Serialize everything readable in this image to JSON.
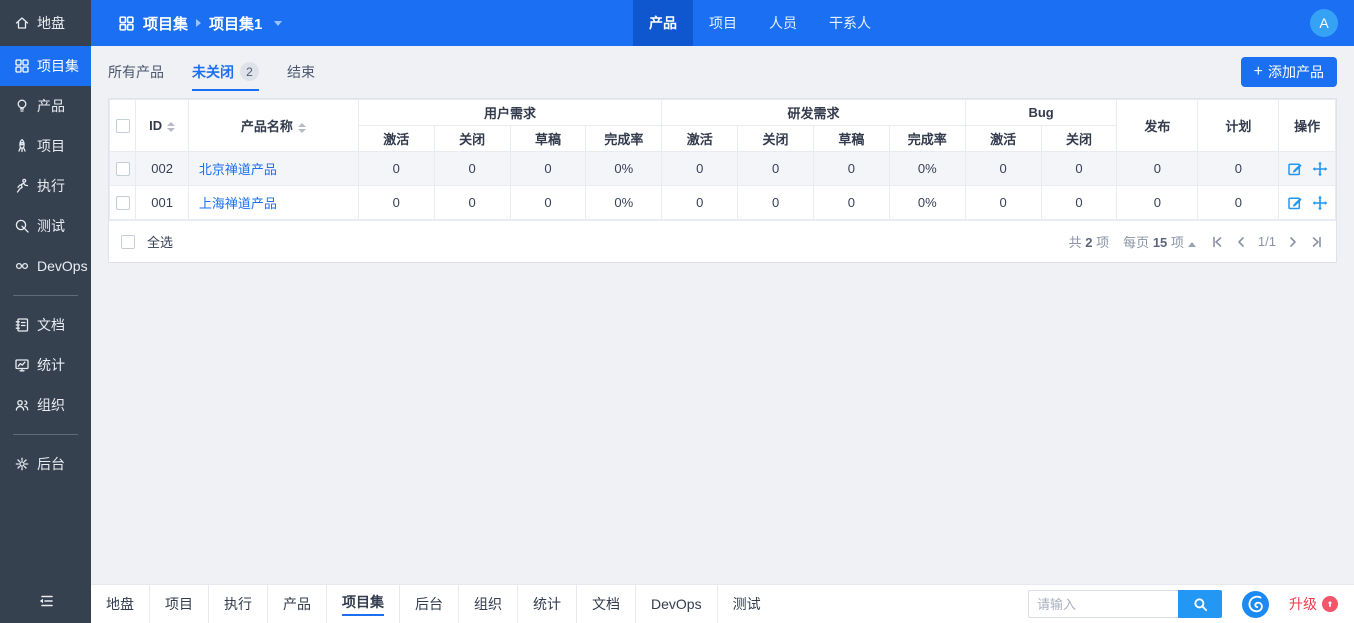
{
  "sidebar": {
    "items": [
      {
        "label": "地盘",
        "icon": "home",
        "active": false
      },
      {
        "label": "项目集",
        "icon": "grid",
        "active": true
      },
      {
        "label": "产品",
        "icon": "bulb",
        "active": false
      },
      {
        "label": "项目",
        "icon": "rocket",
        "active": false
      },
      {
        "label": "执行",
        "icon": "runner",
        "active": false
      },
      {
        "label": "测试",
        "icon": "magnifier",
        "active": false
      },
      {
        "label": "DevOps",
        "icon": "infinity",
        "active": false
      },
      {
        "label": "文档",
        "icon": "notebook",
        "active": false
      },
      {
        "label": "统计",
        "icon": "monitor-chart",
        "active": false
      },
      {
        "label": "组织",
        "icon": "people",
        "active": false
      },
      {
        "label": "后台",
        "icon": "gear",
        "active": false
      }
    ]
  },
  "topbar": {
    "breadcrumb": {
      "root": "项目集",
      "current": "项目集1"
    },
    "tabs": [
      {
        "label": "产品",
        "active": true
      },
      {
        "label": "项目",
        "active": false
      },
      {
        "label": "人员",
        "active": false
      },
      {
        "label": "干系人",
        "active": false
      }
    ],
    "avatar": "A"
  },
  "toolbar": {
    "tabs": [
      {
        "label": "所有产品",
        "active": false
      },
      {
        "label": "未关闭",
        "badge": "2",
        "active": true
      },
      {
        "label": "结束",
        "active": false
      }
    ],
    "add_button": "添加产品"
  },
  "table": {
    "headers": {
      "id": "ID",
      "name": "产品名称",
      "release": "发布",
      "plan": "计划",
      "actions": "操作"
    },
    "groups": [
      {
        "label": "用户需求",
        "cols": [
          "激活",
          "关闭",
          "草稿",
          "完成率"
        ]
      },
      {
        "label": "研发需求",
        "cols": [
          "激活",
          "关闭",
          "草稿",
          "完成率"
        ]
      },
      {
        "label": "Bug",
        "cols": [
          "激活",
          "关闭"
        ]
      }
    ],
    "rows": [
      {
        "id": "002",
        "name": "北京禅道产品",
        "cells": [
          "0",
          "0",
          "0",
          "0%",
          "0",
          "0",
          "0",
          "0%",
          "0",
          "0",
          "0",
          "0"
        ]
      },
      {
        "id": "001",
        "name": "上海禅道产品",
        "cells": [
          "0",
          "0",
          "0",
          "0%",
          "0",
          "0",
          "0",
          "0%",
          "0",
          "0",
          "0",
          "0"
        ]
      }
    ],
    "footer": {
      "select_all": "全选",
      "total_prefix": "共",
      "total_count": "2",
      "total_suffix": "项",
      "perpage_prefix": "每页",
      "perpage_count": "15",
      "perpage_suffix": "项",
      "page": "1/1"
    }
  },
  "bottombar": {
    "items": [
      {
        "label": "地盘",
        "active": false
      },
      {
        "label": "项目",
        "active": false
      },
      {
        "label": "执行",
        "active": false
      },
      {
        "label": "产品",
        "active": false
      },
      {
        "label": "项目集",
        "active": true
      },
      {
        "label": "后台",
        "active": false
      },
      {
        "label": "组织",
        "active": false
      },
      {
        "label": "统计",
        "active": false
      },
      {
        "label": "文档",
        "active": false
      },
      {
        "label": "DevOps",
        "active": false
      },
      {
        "label": "测试",
        "active": false
      }
    ],
    "search_placeholder": "请输入",
    "upgrade_label": "升级"
  },
  "colors": {
    "primary": "#1a6ff2",
    "topbar": "#1a6ff2",
    "topbar_active": "#0e57cf",
    "sidebar_bg": "#364150",
    "content_bg": "#f0f1f4",
    "link": "#1a6ff2",
    "action_icon": "#2196f3",
    "danger": "#f0384a",
    "logo_blue": "#1b8af2"
  }
}
